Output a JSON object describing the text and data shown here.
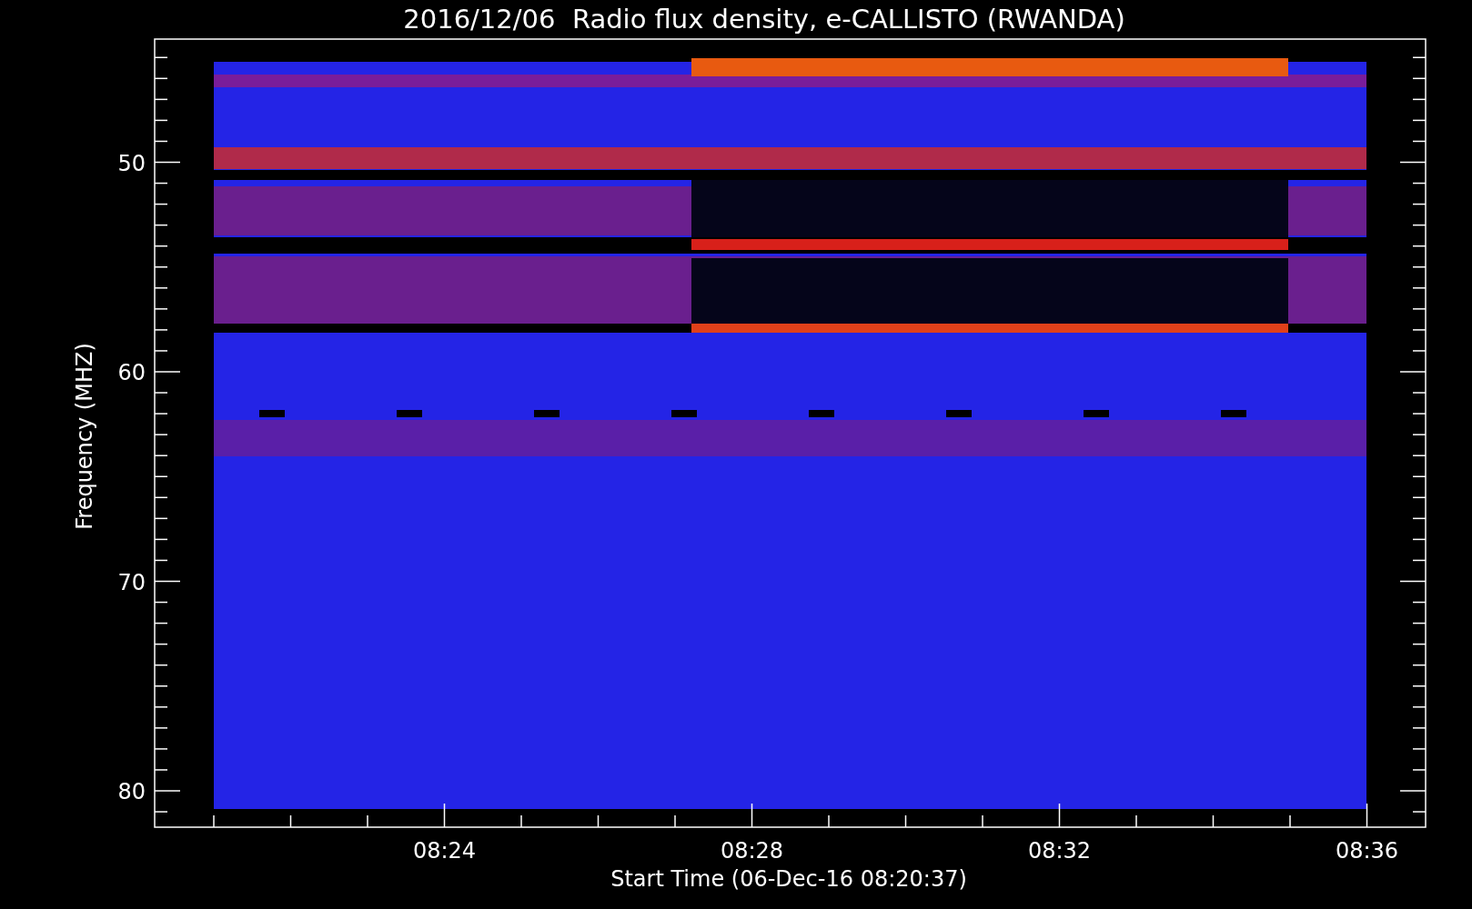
{
  "title": "2016/12/06  Radio flux density, e-CALLISTO (RWANDA)",
  "y_axis": {
    "label": "Frequency (MHZ)",
    "ticks": [
      "50",
      "60",
      "70",
      "80"
    ]
  },
  "x_axis": {
    "label": "Start Time (06-Dec-16 08:20:37)",
    "ticks": [
      "08:24",
      "08:28",
      "08:32",
      "08:36"
    ]
  }
}
